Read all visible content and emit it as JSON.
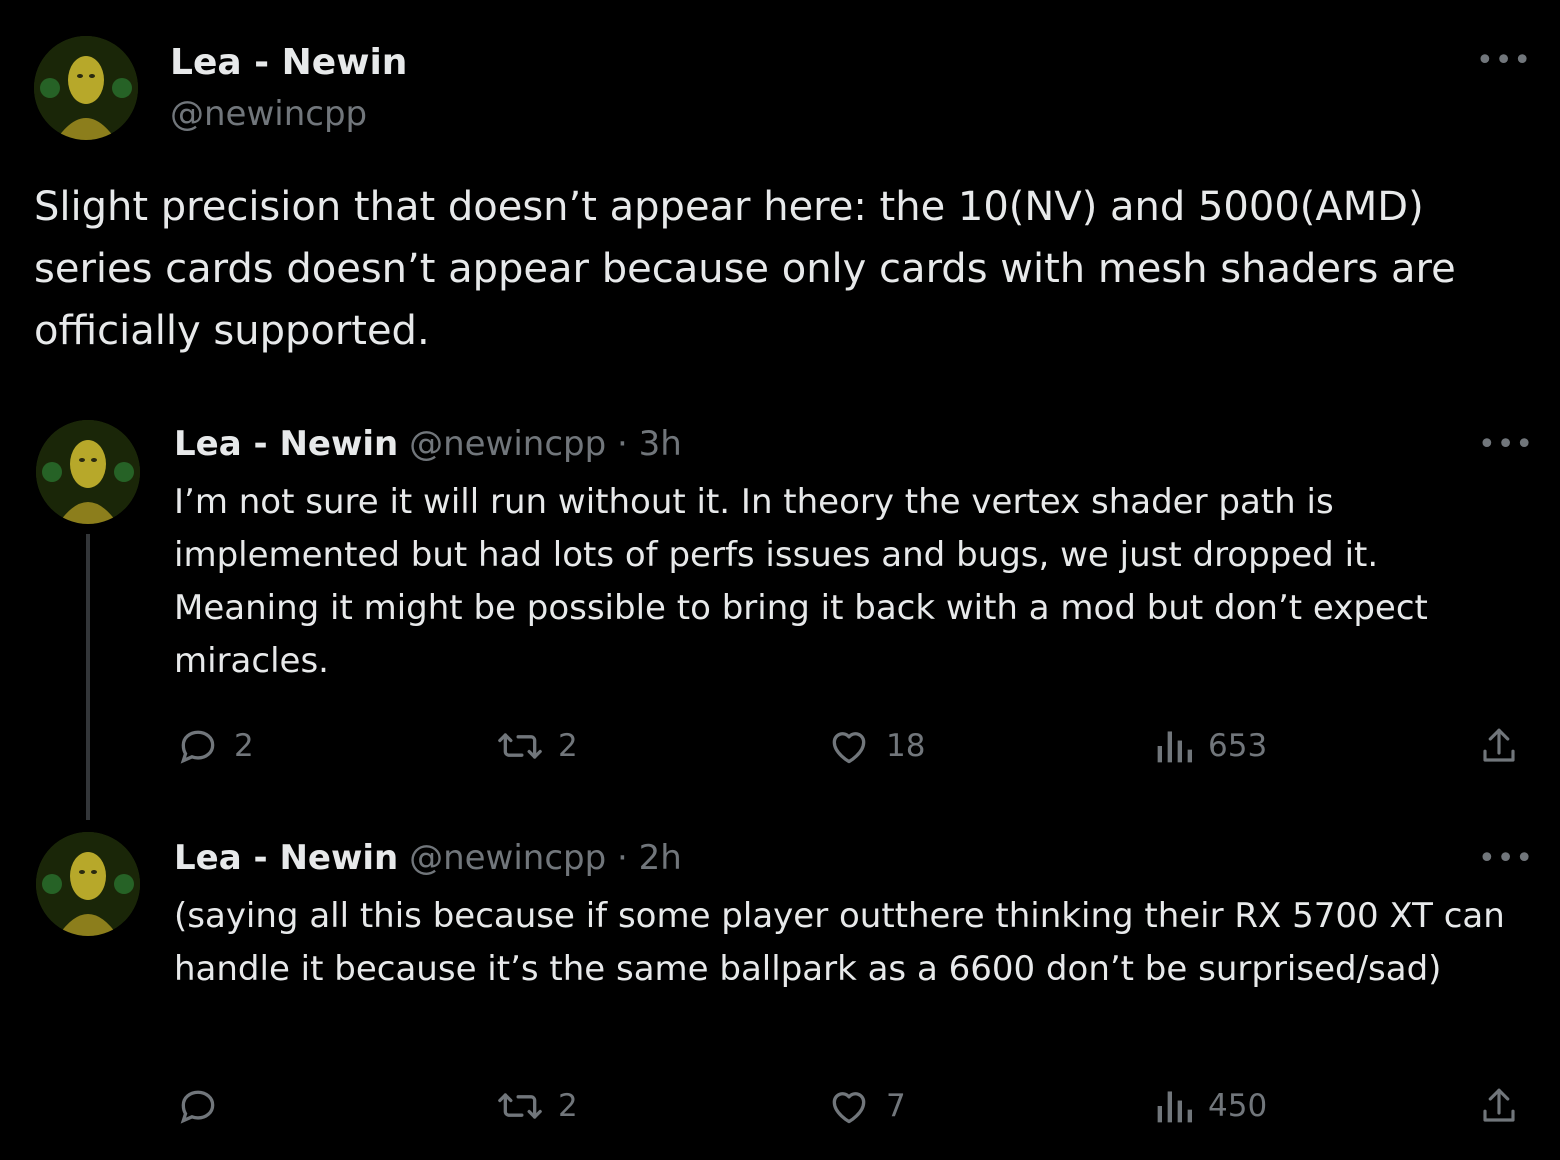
{
  "main_tweet": {
    "display_name": "Lea - Newin",
    "handle": "@newincpp",
    "more_icon": "more-horizontal-icon",
    "text": "Slight precision that doesn’t appear here: the 10(NV) and 5000(AMD) series cards doesn’t appear because only cards with mesh shaders are officially supported."
  },
  "replies": [
    {
      "display_name": "Lea - Newin",
      "meta": "@newincpp · 3h",
      "text": "I’m not sure it will run without it. In theory the vertex shader path is implemented but had lots of perfs issues and bugs, we just dropped it. Meaning it might be possible to bring it back with a mod but don’t expect miracles.",
      "actions": {
        "replies": "2",
        "reposts": "2",
        "likes": "18",
        "views": "653"
      }
    },
    {
      "display_name": "Lea - Newin",
      "meta": "@newincpp · 2h",
      "text": "(saying all this because if some player outthere thinking their RX 5700 XT can handle it because it’s the same ballpark as a 6600 don’t be surprised/sad)",
      "actions": {
        "replies": "",
        "reposts": "2",
        "likes": "7",
        "views": "450"
      }
    }
  ],
  "colors": {
    "background": "#000000",
    "text_primary": "#e7e9ea",
    "text_secondary": "#71767b",
    "thread_line": "#333639"
  },
  "icons": {
    "reply": "reply-bubble-icon",
    "repost": "repost-icon",
    "like": "heart-icon",
    "views": "views-bar-chart-icon",
    "share": "share-upload-icon"
  }
}
